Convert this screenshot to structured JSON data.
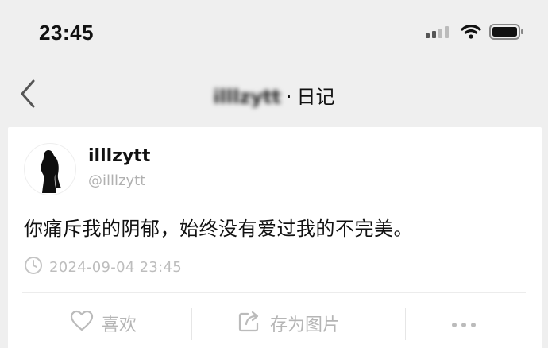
{
  "status_bar": {
    "time": "23:45"
  },
  "nav": {
    "title_user": "illlzytt",
    "title_separator": "·",
    "title_section": "日记"
  },
  "post": {
    "author_name": "illlzytt",
    "author_handle": "@illlzytt",
    "text": "你痛斥我的阴郁，始终没有爱过我的不完美。",
    "timestamp": "2024-09-04 23:45"
  },
  "actions": {
    "like_label": "喜欢",
    "save_image_label": "存为图片"
  },
  "icons": {
    "back": "chevron-left-icon",
    "signal": "signal-icon",
    "wifi": "wifi-icon",
    "battery": "battery-icon",
    "clock": "clock-icon",
    "like": "heart-icon",
    "share": "share-icon",
    "more": "more-icon"
  },
  "colors": {
    "background": "#efefef",
    "card": "#ffffff",
    "muted_text": "#bdbdbd"
  }
}
